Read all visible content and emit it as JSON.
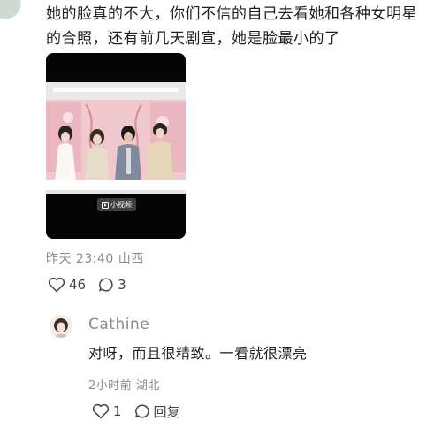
{
  "comment": {
    "line1": "她的脸真的不大，你们不信的自己去看她和各种女明星",
    "line2": "的合照，还有前几天剧宣，她是脸最小的了",
    "video": {
      "badge_label": "小视频",
      "icon": "play-video-icon"
    },
    "meta": "昨天 23:40 山西",
    "likes": "46",
    "comments": "3"
  },
  "reply": {
    "author": "Cathine",
    "text": "对呀，而且很精致。一看就很漂亮",
    "meta": "2小时前 湖北",
    "likes": "1",
    "reply_label": "回复"
  },
  "colors": {
    "text": "#1e1e1e",
    "meta": "#8a8a8a",
    "video_bg": "#050505"
  }
}
